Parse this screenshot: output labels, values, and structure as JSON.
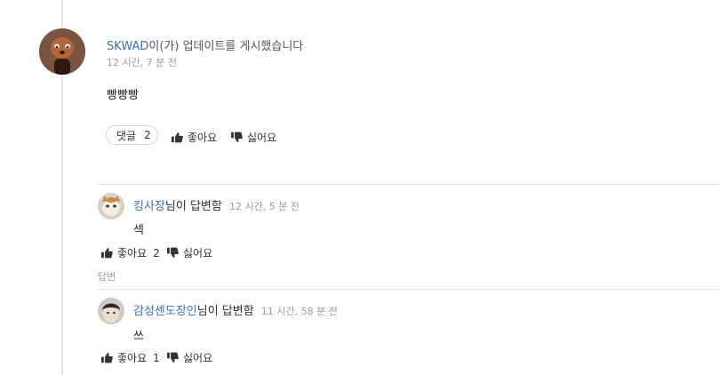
{
  "post": {
    "author": "SKWAD",
    "action_text": "이(가) 업데이트를 게시했습니다",
    "time": "12 시간, 7 분 전",
    "body": "빵빵빵",
    "comments_label": "댓글",
    "comments_count": "2",
    "like_label": "좋아요",
    "dislike_label": "싫어요"
  },
  "replies": [
    {
      "author": "킹사장",
      "action_text": "님이 답변함",
      "time": "12 시간, 5 분 전",
      "body": "섹",
      "like_label": "좋아요",
      "like_count": "2",
      "dislike_label": "싫어요",
      "reply_label": "답변"
    },
    {
      "author": "감성센도장인",
      "action_text": "님이 답변함",
      "time": "11 시간, 58 분 전",
      "body": "쓰",
      "like_label": "좋아요",
      "like_count": "1",
      "dislike_label": "싫어요"
    }
  ],
  "colors": {
    "author_link": "#3b6fb6",
    "muted": "#9a9a9a",
    "divider": "#e3e3e3"
  }
}
